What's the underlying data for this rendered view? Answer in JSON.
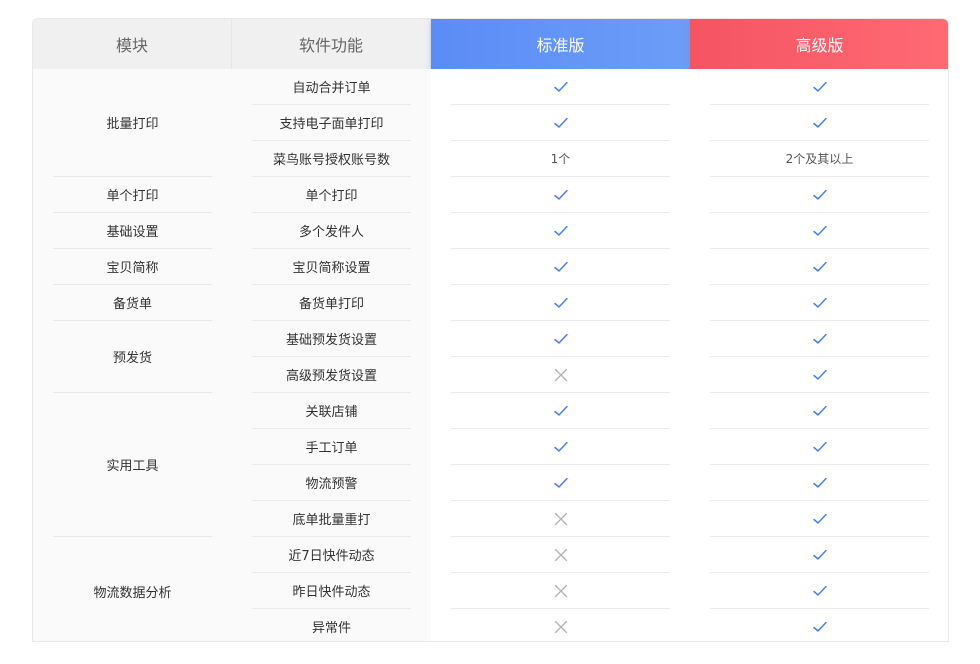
{
  "header": {
    "module": "模块",
    "feature": "软件功能",
    "standard": "标准版",
    "advanced": "高级版"
  },
  "modules": [
    {
      "label": "批量打印",
      "rows": 3
    },
    {
      "label": "单个打印",
      "rows": 1
    },
    {
      "label": "基础设置",
      "rows": 1
    },
    {
      "label": "宝贝简称",
      "rows": 1
    },
    {
      "label": "备货单",
      "rows": 1
    },
    {
      "label": "预发货",
      "rows": 2
    },
    {
      "label": "实用工具",
      "rows": 4
    },
    {
      "label": "物流数据分析",
      "rows": 3
    }
  ],
  "rows": [
    {
      "feature": "自动合并订单",
      "standard": "check",
      "advanced": "check"
    },
    {
      "feature": "支持电子面单打印",
      "standard": "check",
      "advanced": "check"
    },
    {
      "feature": "菜鸟账号授权账号数",
      "standard": "1个",
      "advanced": "2个及其以上"
    },
    {
      "feature": "单个打印",
      "standard": "check",
      "advanced": "check"
    },
    {
      "feature": "多个发件人",
      "standard": "check",
      "advanced": "check"
    },
    {
      "feature": "宝贝简称设置",
      "standard": "check",
      "advanced": "check"
    },
    {
      "feature": "备货单打印",
      "standard": "check",
      "advanced": "check"
    },
    {
      "feature": "基础预发货设置",
      "standard": "check",
      "advanced": "check"
    },
    {
      "feature": "高级预发货设置",
      "standard": "cross",
      "advanced": "check"
    },
    {
      "feature": "关联店铺",
      "standard": "check",
      "advanced": "check"
    },
    {
      "feature": "手工订单",
      "standard": "check",
      "advanced": "check"
    },
    {
      "feature": "物流预警",
      "standard": "check",
      "advanced": "check"
    },
    {
      "feature": "底单批量重打",
      "standard": "cross",
      "advanced": "check"
    },
    {
      "feature": "近7日快件动态",
      "standard": "cross",
      "advanced": "check"
    },
    {
      "feature": "昨日快件动态",
      "standard": "cross",
      "advanced": "check"
    },
    {
      "feature": "异常件",
      "standard": "cross",
      "advanced": "check"
    }
  ],
  "colors": {
    "check": "#4a7ff0",
    "cross": "#b3b3b3",
    "standard_header": "#5f91f7",
    "advanced_header": "#f85d69"
  }
}
